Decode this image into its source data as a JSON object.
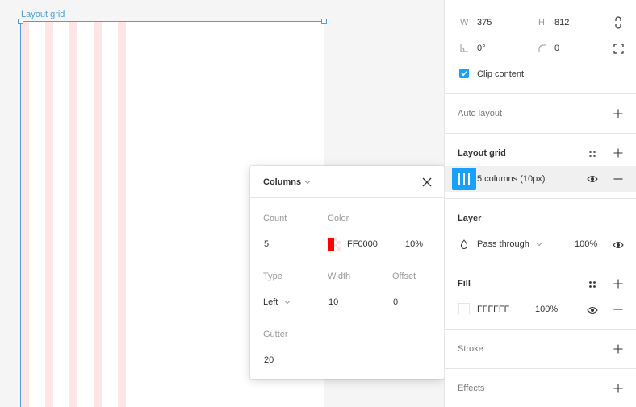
{
  "canvas": {
    "frame_label": "Layout grid",
    "grid_color": "#FFE5E5"
  },
  "popup": {
    "title": "Columns",
    "count_label": "Count",
    "count_value": "5",
    "color_label": "Color",
    "color_hex": "FF0000",
    "color_opacity": "10%",
    "swatch_color": "#FF0000",
    "type_label": "Type",
    "type_value": "Left",
    "width_label": "Width",
    "width_value": "10",
    "offset_label": "Offset",
    "offset_value": "0",
    "gutter_label": "Gutter",
    "gutter_value": "20"
  },
  "panel": {
    "w_label": "W",
    "w_value": "375",
    "h_label": "H",
    "h_value": "812",
    "rotation_value": "0°",
    "radius_value": "0",
    "clip_content_label": "Clip content",
    "auto_layout_label": "Auto layout",
    "layout_grid_label": "Layout grid",
    "grid_item_label": "5 columns (10px)",
    "layer_label": "Layer",
    "blend_mode": "Pass through",
    "layer_opacity": "100%",
    "fill_label": "Fill",
    "fill_hex": "FFFFFF",
    "fill_opacity": "100%",
    "stroke_label": "Stroke",
    "effects_label": "Effects",
    "accent_color": "#18A0FB"
  }
}
